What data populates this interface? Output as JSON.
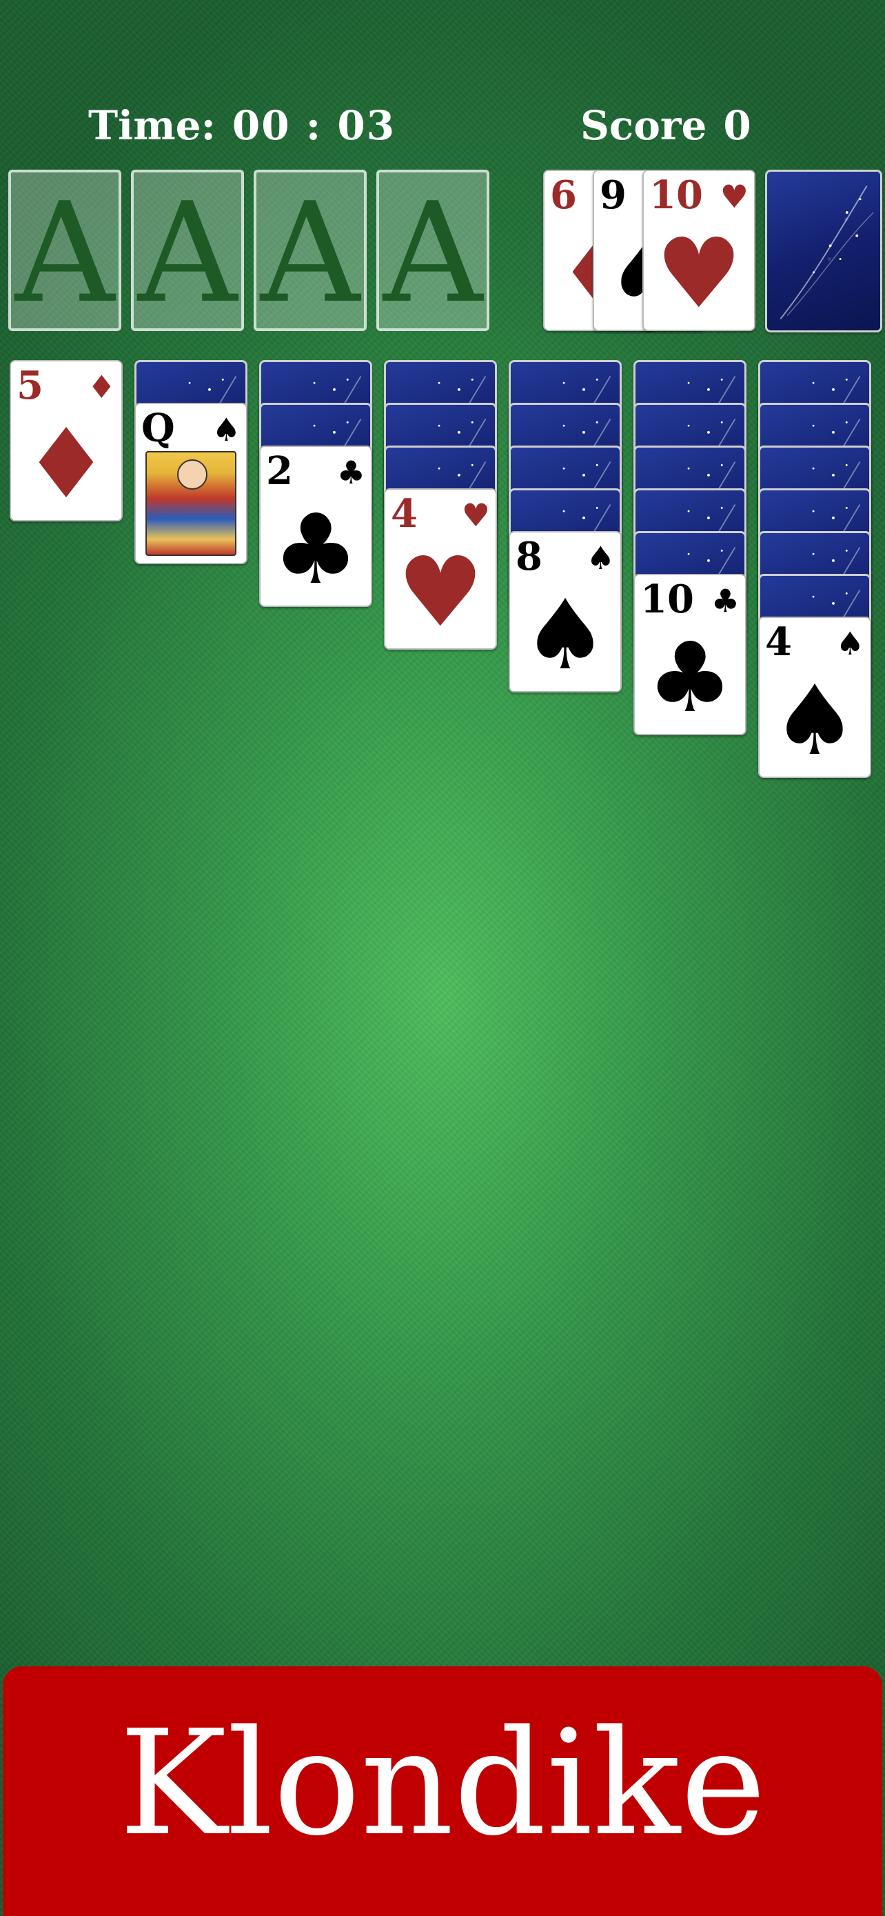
{
  "hud": {
    "time_label": "Time:",
    "time_value": "00 : 03",
    "score_label": "Score",
    "score_value": "0"
  },
  "foundations": [
    "A",
    "A",
    "A",
    "A"
  ],
  "waste": [
    {
      "rank": "6",
      "suit": "♦",
      "color": "#9c2a28"
    },
    {
      "rank": "9",
      "suit": "♠",
      "color": "#000000"
    },
    {
      "rank": "10",
      "suit": "♥",
      "color": "#9c2a28"
    }
  ],
  "tableau": [
    {
      "hidden": 0,
      "rank": "5",
      "suit": "♦",
      "color": "#9c2a28"
    },
    {
      "hidden": 1,
      "rank": "Q",
      "suit": "♠",
      "color": "#000000"
    },
    {
      "hidden": 2,
      "rank": "2",
      "suit": "♣",
      "color": "#000000"
    },
    {
      "hidden": 3,
      "rank": "4",
      "suit": "♥",
      "color": "#9c2a28"
    },
    {
      "hidden": 4,
      "rank": "8",
      "suit": "♠",
      "color": "#000000"
    },
    {
      "hidden": 5,
      "rank": "10",
      "suit": "♣",
      "color": "#000000"
    },
    {
      "hidden": 6,
      "rank": "4",
      "suit": "♠",
      "color": "#000000"
    }
  ],
  "banner": {
    "title": "Klondike",
    "color": "#c00000"
  }
}
